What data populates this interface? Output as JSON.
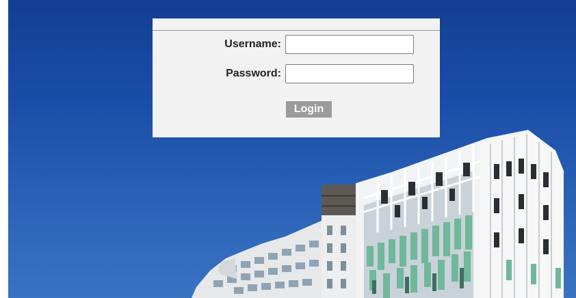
{
  "login": {
    "username_label": "Username:",
    "username_value": "",
    "password_label": "Password:",
    "password_value": "",
    "login_label": "Login"
  },
  "colors": {
    "sky": "#1b4ea8",
    "panel": "#f2f2f2",
    "button": "#9b9b9b",
    "facade_green": "#6fb89a"
  },
  "background": {
    "icon": "building-photo"
  }
}
